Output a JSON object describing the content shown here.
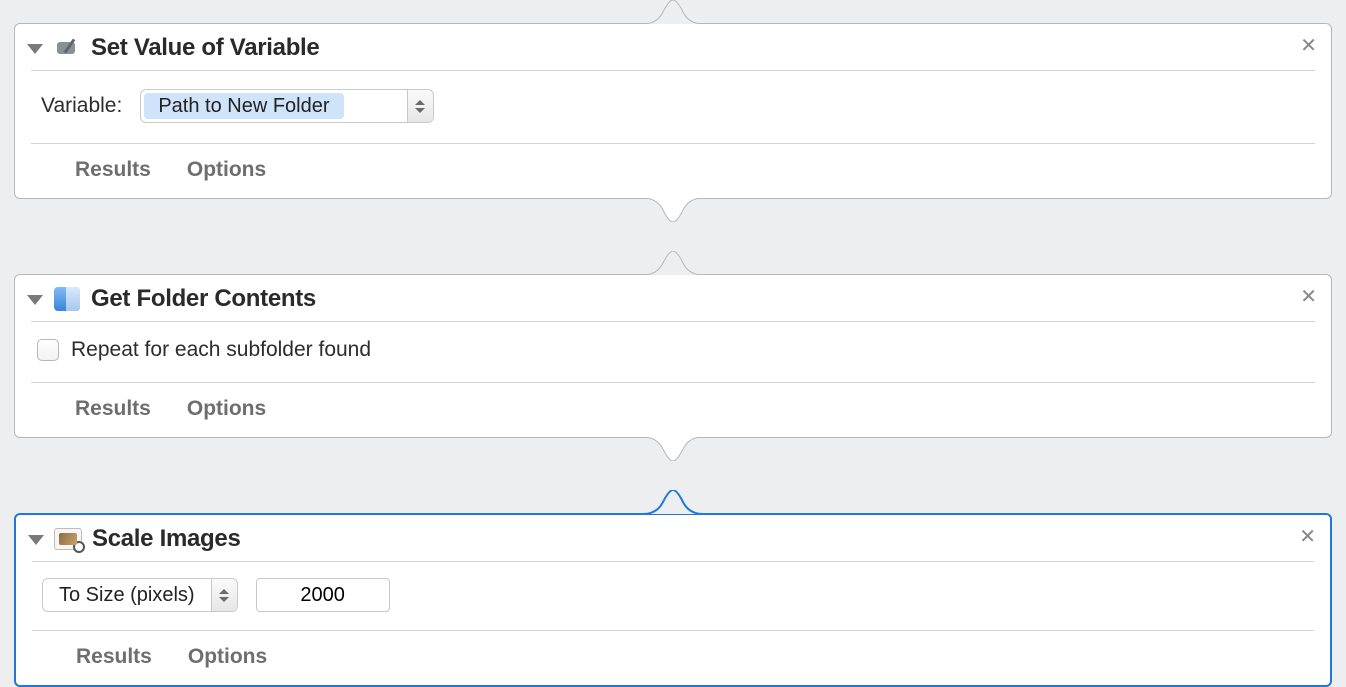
{
  "common": {
    "results_label": "Results",
    "options_label": "Options"
  },
  "actions": [
    {
      "title": "Set Value of Variable",
      "variable_label": "Variable:",
      "variable_value": "Path to New Folder"
    },
    {
      "title": "Get Folder Contents",
      "repeat_label": "Repeat for each subfolder found",
      "repeat_checked": false
    },
    {
      "title": "Scale Images",
      "mode": "To Size (pixels)",
      "value": "2000",
      "selected": true
    }
  ]
}
